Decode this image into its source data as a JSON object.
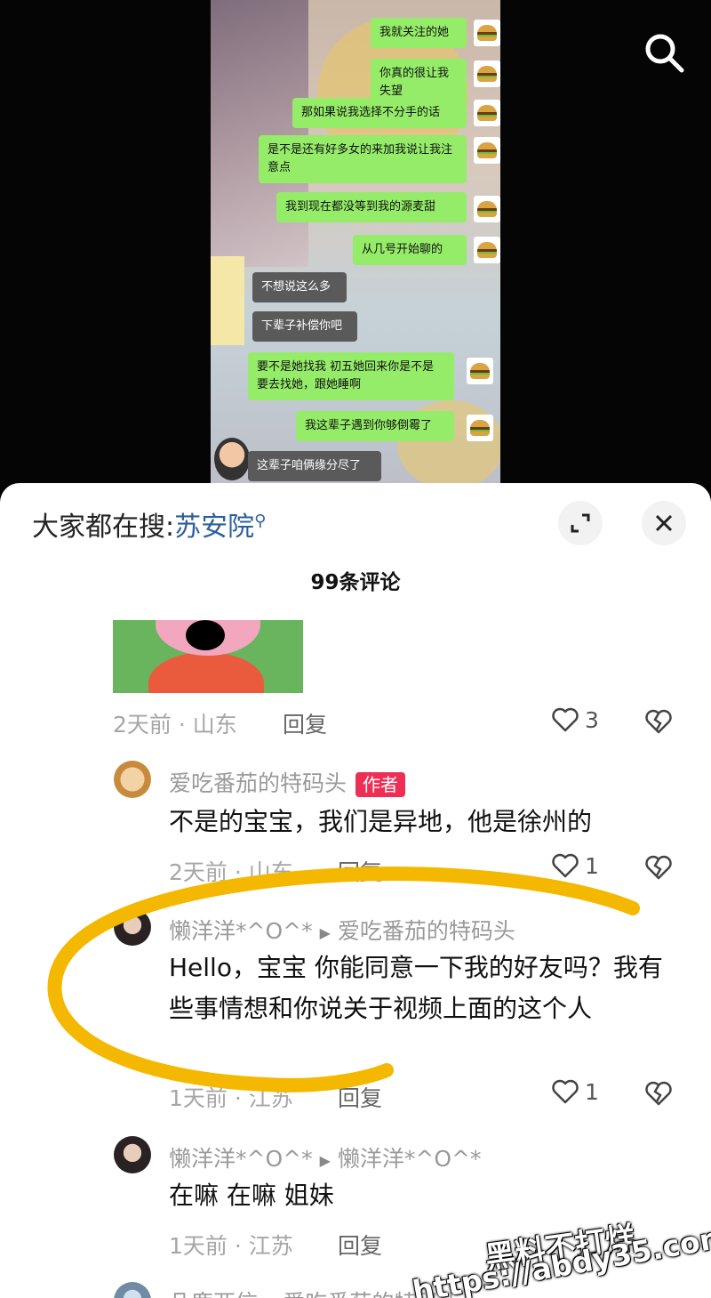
{
  "video": {
    "messages": [
      {
        "side": "me",
        "text": "我就关注的她"
      },
      {
        "side": "me",
        "text": "你真的很让我失望"
      },
      {
        "side": "me",
        "text": "那如果说我选择不分手的话"
      },
      {
        "side": "me",
        "text": "是不是还有好多女的来加我说让我注意点"
      },
      {
        "side": "me",
        "text": "我到现在都没等到我的源麦甜"
      },
      {
        "side": "me",
        "text": "从几号开始聊的"
      },
      {
        "side": "them",
        "text": "不想说这么多"
      },
      {
        "side": "them",
        "text": "下辈子补偿你吧"
      },
      {
        "side": "me",
        "text": "要不是她找我 初五她回来你是不是要去找她，跟她睡啊"
      },
      {
        "side": "me",
        "text": "我这辈子遇到你够倒霉了"
      },
      {
        "side": "them",
        "text": "这辈子咱俩缘分尽了"
      }
    ]
  },
  "sheet": {
    "search_prefix": "大家都在搜:",
    "search_term": "苏安院",
    "comment_count": "99条评论",
    "reply_label": "回复"
  },
  "comments": [
    {
      "meta": "2天前 · 山东",
      "likes": "3"
    },
    {
      "name": "爱吃番茄的特码头",
      "tag": "作者",
      "text": "不是的宝宝，我们是异地，他是徐州的",
      "meta": "2天前 · 山东",
      "likes": "1"
    },
    {
      "name": "懒洋洋*^O^*",
      "reply_to": "爱吃番茄的特码头",
      "text": "Hello，宝宝 你能同意一下我的好友吗？我有些事情想和你说关于视频上面的这个人",
      "meta": "1天前 · 江苏",
      "likes": "1"
    },
    {
      "name": "懒洋洋*^O^*",
      "reply_to": "懒洋洋*^O^*",
      "text": "在嘛 在嘛 姐妹",
      "meta": "1天前 · 江苏"
    },
    {
      "name": "凡鹿两信",
      "reply_to": "爱吃番茄的特码头"
    }
  ],
  "watermark": {
    "line1": "黑料不打烊",
    "line2": "https://abdy35.com"
  },
  "colors": {
    "highlight": "#f5b800",
    "author_tag": "#ee2e55",
    "wechat_green": "#95ec69"
  }
}
